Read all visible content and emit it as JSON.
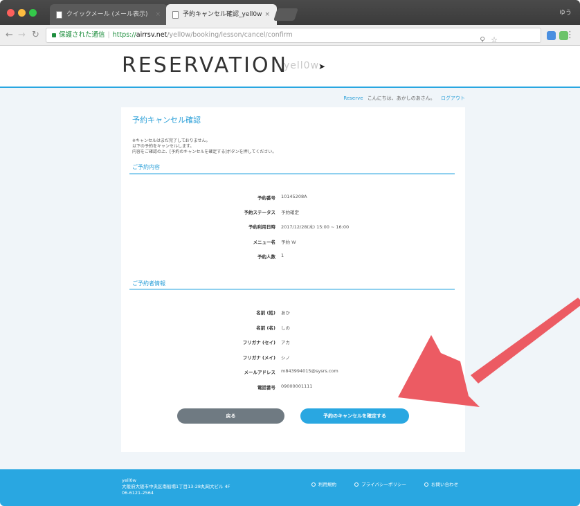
{
  "browser": {
    "tabs": [
      {
        "title": "クイックメール (メール表示)",
        "active": false
      },
      {
        "title": "予約キャンセル確認_yell0w",
        "active": true
      }
    ],
    "profile": "ゆう",
    "address": {
      "secure_label": "保護された通信",
      "scheme": "https://",
      "host": "airrsv.net",
      "path": "/yell0w/booking/lesson/cancel/confirm"
    }
  },
  "header": {
    "logo": "RESERVATION",
    "sub_logo": "yell0w"
  },
  "userbar": {
    "brand": "Reserve",
    "greeting": "こんにちは、あかしのあさん。",
    "logout": "ログアウト"
  },
  "card": {
    "title": "予約キャンセル確認",
    "notes": [
      "※キャンセルはまだ完了しておりません。",
      "以下の予約をキャンセルします。",
      "内容をご確認の上、[予約のキャンセルを確定する]ボタンを押してください。"
    ],
    "reservation_section": "ご予約内容",
    "reservation": [
      {
        "label": "予約番号",
        "value": "10145208A"
      },
      {
        "label": "予約ステータス",
        "value": "予約確定"
      },
      {
        "label": "予約利用日時",
        "value": "2017/12/28(木) 15:00 ~ 16:00"
      },
      {
        "label": "メニュー名",
        "value": "予約 W"
      },
      {
        "label": "予約人数",
        "value": "1"
      }
    ],
    "applicant_section": "ご予約者情報",
    "applicant": [
      {
        "label": "名前 (姓)",
        "value": "あか"
      },
      {
        "label": "名前 (名)",
        "value": "しの"
      },
      {
        "label": "フリガナ (セイ)",
        "value": "アカ"
      },
      {
        "label": "フリガナ (メイ)",
        "value": "シノ"
      },
      {
        "label": "メールアドレス",
        "value": "m843994015@sysrs.com"
      },
      {
        "label": "電話番号",
        "value": "09000001111"
      }
    ],
    "back_button": "戻る",
    "confirm_button": "予約のキャンセルを確定する"
  },
  "footer": {
    "name": "yell0w",
    "address": "大阪府大阪市中央区南船場1丁目13-28丸岡大ビル 4F",
    "phone": "06-6121-2564",
    "links": [
      "利用規約",
      "プライバシーポリシー",
      "お問い合わせ"
    ]
  },
  "colors": {
    "accent": "#29a7e1",
    "arrow": "#ec5b63",
    "back_button": "#6f7a82"
  }
}
